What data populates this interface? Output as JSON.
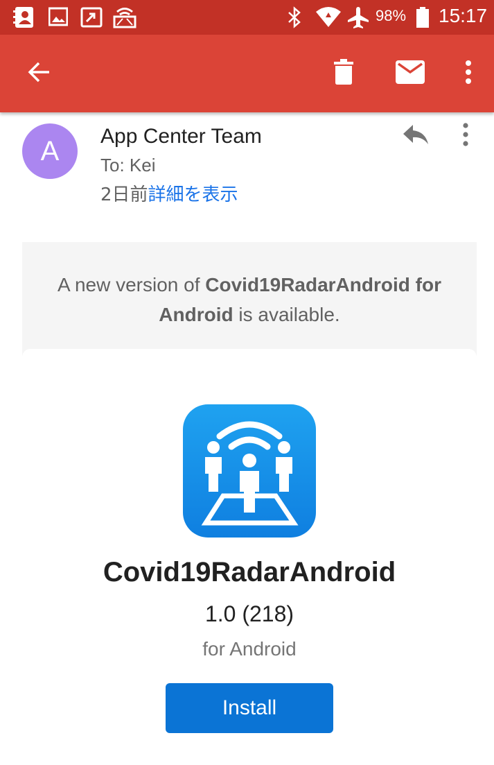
{
  "status_bar": {
    "battery": "98%",
    "time": "15:17",
    "icons": [
      "contacts-notification-icon",
      "image-notification-icon",
      "cast-notification-icon",
      "wifi-display-notification-icon",
      "bluetooth-icon",
      "wifi-icon",
      "airplane-mode-icon",
      "battery-icon"
    ]
  },
  "app_bar": {
    "background": "#db4437",
    "actions": [
      "back-icon",
      "delete-icon",
      "mark-unread-icon",
      "more-vert-icon"
    ]
  },
  "email_header": {
    "avatar_letter": "A",
    "avatar_color": "#ab86f0",
    "sender": "App Center Team",
    "to": "To: Kei",
    "date": "2日前",
    "details_link": "詳細を表示"
  },
  "banner": {
    "prefix": "A new version of ",
    "app_bold": "Covid19RadarAndroid for Android",
    "suffix": " is available."
  },
  "app_card": {
    "name": "Covid19RadarAndroid",
    "version": "1.0 (218)",
    "platform": "for Android",
    "install_label": "Install",
    "icon": "covid-radar-app-icon",
    "accent": "#0b74d5"
  }
}
